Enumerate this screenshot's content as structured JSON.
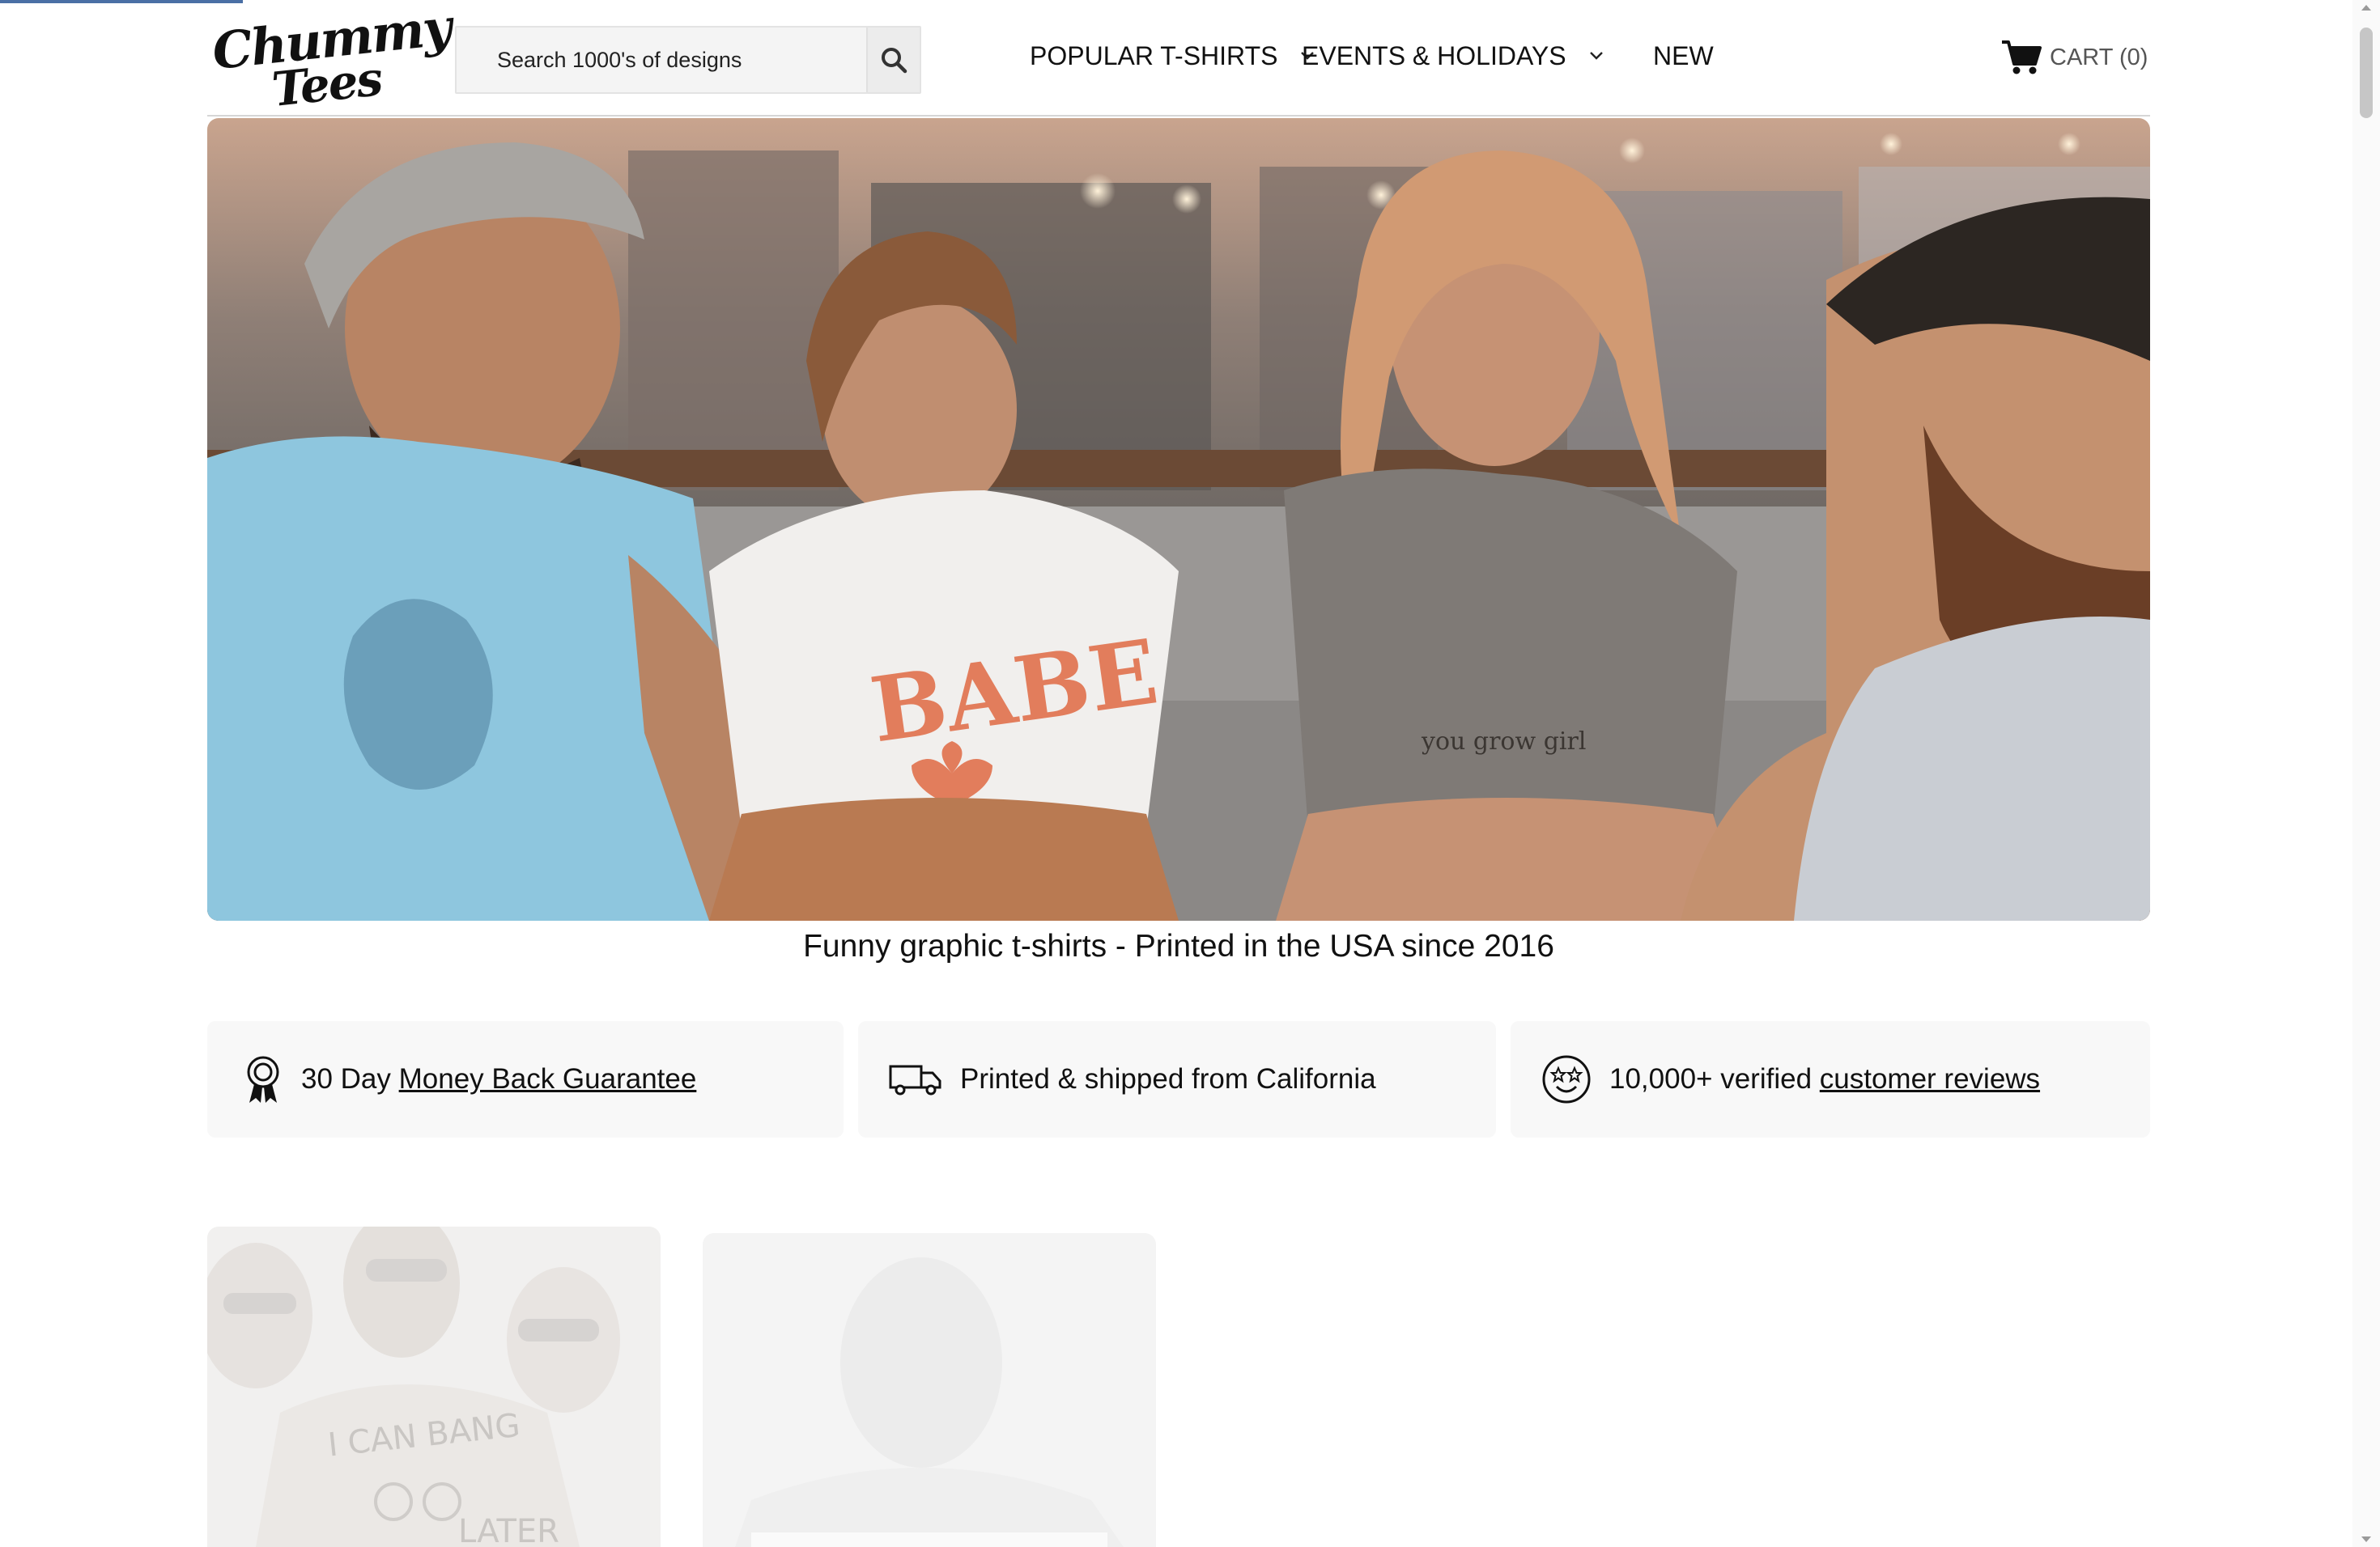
{
  "brand": {
    "line1": "Chummy",
    "line2": "Tees"
  },
  "search": {
    "placeholder": "Search 1000's of designs"
  },
  "nav": {
    "items": [
      {
        "label": "POPULAR T-SHIRTS"
      },
      {
        "label": "EVENTS & HOLIDAYS"
      },
      {
        "label": "NEW"
      }
    ]
  },
  "cart": {
    "label": "CART (0)"
  },
  "hero": {
    "tagline": "Funny graphic t-shirts - Printed in the USA since 2016",
    "shirt_babe": "BABE",
    "shirt_grow": "you grow girl"
  },
  "benefits": {
    "guarantee": {
      "prefix": "30 Day ",
      "link": "Money Back Guarantee"
    },
    "shipping": {
      "text": "Printed & shipped from California"
    },
    "reviews": {
      "prefix": "10,000+ verified ",
      "link": "customer reviews"
    }
  },
  "cards": {
    "card1_shirt_line1": "I CAN BANG",
    "card1_shirt_line2": "LATER"
  },
  "colors": {
    "accent_bar": "#4a6fa5",
    "text": "#111111",
    "panel": "#f8f8f8"
  }
}
